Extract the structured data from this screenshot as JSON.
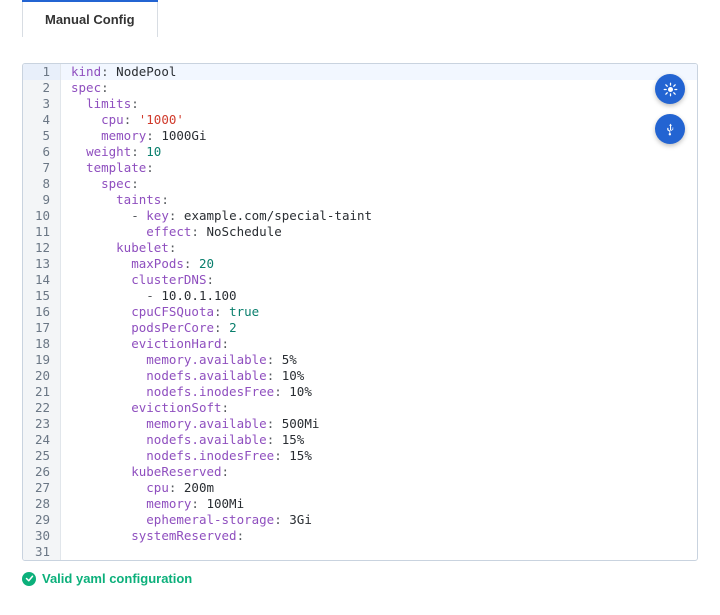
{
  "tabs": [
    {
      "label": "Manual Config",
      "selected": true
    }
  ],
  "actions": {
    "theme_label": "Toggle theme",
    "usb_label": "Connect device"
  },
  "status": {
    "text": "Valid yaml configuration"
  },
  "editor": {
    "highlight_line": 1,
    "lines": [
      {
        "tokens": [
          {
            "t": "k",
            "v": "kind"
          },
          {
            "t": "col",
            "v": ": "
          },
          {
            "t": "pln",
            "v": "NodePool"
          }
        ]
      },
      {
        "tokens": [
          {
            "t": "k",
            "v": "spec"
          },
          {
            "t": "col",
            "v": ":"
          }
        ]
      },
      {
        "tokens": [
          {
            "t": "sp",
            "v": "  "
          },
          {
            "t": "k",
            "v": "limits"
          },
          {
            "t": "col",
            "v": ":"
          }
        ]
      },
      {
        "tokens": [
          {
            "t": "sp",
            "v": "    "
          },
          {
            "t": "k",
            "v": "cpu"
          },
          {
            "t": "col",
            "v": ": "
          },
          {
            "t": "str",
            "v": "'1000'"
          }
        ]
      },
      {
        "tokens": [
          {
            "t": "sp",
            "v": "    "
          },
          {
            "t": "k",
            "v": "memory"
          },
          {
            "t": "col",
            "v": ": "
          },
          {
            "t": "pln",
            "v": "1000Gi"
          }
        ]
      },
      {
        "tokens": [
          {
            "t": "sp",
            "v": "  "
          },
          {
            "t": "k",
            "v": "weight"
          },
          {
            "t": "col",
            "v": ": "
          },
          {
            "t": "num",
            "v": "10"
          }
        ]
      },
      {
        "tokens": [
          {
            "t": "sp",
            "v": "  "
          },
          {
            "t": "k",
            "v": "template"
          },
          {
            "t": "col",
            "v": ":"
          }
        ]
      },
      {
        "tokens": [
          {
            "t": "sp",
            "v": "    "
          },
          {
            "t": "k",
            "v": "spec"
          },
          {
            "t": "col",
            "v": ":"
          }
        ]
      },
      {
        "tokens": [
          {
            "t": "sp",
            "v": "      "
          },
          {
            "t": "k",
            "v": "taints"
          },
          {
            "t": "col",
            "v": ":"
          }
        ]
      },
      {
        "tokens": [
          {
            "t": "sp",
            "v": "        "
          },
          {
            "t": "dsh",
            "v": "- "
          },
          {
            "t": "k",
            "v": "key"
          },
          {
            "t": "col",
            "v": ": "
          },
          {
            "t": "pln",
            "v": "example.com/special-taint"
          }
        ]
      },
      {
        "tokens": [
          {
            "t": "sp",
            "v": "          "
          },
          {
            "t": "k",
            "v": "effect"
          },
          {
            "t": "col",
            "v": ": "
          },
          {
            "t": "pln",
            "v": "NoSchedule"
          }
        ]
      },
      {
        "tokens": [
          {
            "t": "sp",
            "v": "      "
          },
          {
            "t": "k",
            "v": "kubelet"
          },
          {
            "t": "col",
            "v": ":"
          }
        ]
      },
      {
        "tokens": [
          {
            "t": "sp",
            "v": "        "
          },
          {
            "t": "k",
            "v": "maxPods"
          },
          {
            "t": "col",
            "v": ": "
          },
          {
            "t": "num",
            "v": "20"
          }
        ]
      },
      {
        "tokens": [
          {
            "t": "sp",
            "v": "        "
          },
          {
            "t": "k",
            "v": "clusterDNS"
          },
          {
            "t": "col",
            "v": ":"
          }
        ]
      },
      {
        "tokens": [
          {
            "t": "sp",
            "v": "          "
          },
          {
            "t": "dsh",
            "v": "- "
          },
          {
            "t": "pln",
            "v": "10.0.1.100"
          }
        ]
      },
      {
        "tokens": [
          {
            "t": "sp",
            "v": "        "
          },
          {
            "t": "k",
            "v": "cpuCFSQuota"
          },
          {
            "t": "col",
            "v": ": "
          },
          {
            "t": "lit",
            "v": "true"
          }
        ]
      },
      {
        "tokens": [
          {
            "t": "sp",
            "v": "        "
          },
          {
            "t": "k",
            "v": "podsPerCore"
          },
          {
            "t": "col",
            "v": ": "
          },
          {
            "t": "num",
            "v": "2"
          }
        ]
      },
      {
        "tokens": [
          {
            "t": "sp",
            "v": "        "
          },
          {
            "t": "k",
            "v": "evictionHard"
          },
          {
            "t": "col",
            "v": ":"
          }
        ]
      },
      {
        "tokens": [
          {
            "t": "sp",
            "v": "          "
          },
          {
            "t": "k",
            "v": "memory.available"
          },
          {
            "t": "col",
            "v": ": "
          },
          {
            "t": "pln",
            "v": "5%"
          }
        ]
      },
      {
        "tokens": [
          {
            "t": "sp",
            "v": "          "
          },
          {
            "t": "k",
            "v": "nodefs.available"
          },
          {
            "t": "col",
            "v": ": "
          },
          {
            "t": "pln",
            "v": "10%"
          }
        ]
      },
      {
        "tokens": [
          {
            "t": "sp",
            "v": "          "
          },
          {
            "t": "k",
            "v": "nodefs.inodesFree"
          },
          {
            "t": "col",
            "v": ": "
          },
          {
            "t": "pln",
            "v": "10%"
          }
        ]
      },
      {
        "tokens": [
          {
            "t": "sp",
            "v": "        "
          },
          {
            "t": "k",
            "v": "evictionSoft"
          },
          {
            "t": "col",
            "v": ":"
          }
        ]
      },
      {
        "tokens": [
          {
            "t": "sp",
            "v": "          "
          },
          {
            "t": "k",
            "v": "memory.available"
          },
          {
            "t": "col",
            "v": ": "
          },
          {
            "t": "pln",
            "v": "500Mi"
          }
        ]
      },
      {
        "tokens": [
          {
            "t": "sp",
            "v": "          "
          },
          {
            "t": "k",
            "v": "nodefs.available"
          },
          {
            "t": "col",
            "v": ": "
          },
          {
            "t": "pln",
            "v": "15%"
          }
        ]
      },
      {
        "tokens": [
          {
            "t": "sp",
            "v": "          "
          },
          {
            "t": "k",
            "v": "nodefs.inodesFree"
          },
          {
            "t": "col",
            "v": ": "
          },
          {
            "t": "pln",
            "v": "15%"
          }
        ]
      },
      {
        "tokens": [
          {
            "t": "sp",
            "v": "        "
          },
          {
            "t": "k",
            "v": "kubeReserved"
          },
          {
            "t": "col",
            "v": ":"
          }
        ]
      },
      {
        "tokens": [
          {
            "t": "sp",
            "v": "          "
          },
          {
            "t": "k",
            "v": "cpu"
          },
          {
            "t": "col",
            "v": ": "
          },
          {
            "t": "pln",
            "v": "200m"
          }
        ]
      },
      {
        "tokens": [
          {
            "t": "sp",
            "v": "          "
          },
          {
            "t": "k",
            "v": "memory"
          },
          {
            "t": "col",
            "v": ": "
          },
          {
            "t": "pln",
            "v": "100Mi"
          }
        ]
      },
      {
        "tokens": [
          {
            "t": "sp",
            "v": "          "
          },
          {
            "t": "k",
            "v": "ephemeral-storage"
          },
          {
            "t": "col",
            "v": ": "
          },
          {
            "t": "pln",
            "v": "3Gi"
          }
        ]
      },
      {
        "tokens": [
          {
            "t": "sp",
            "v": "        "
          },
          {
            "t": "k",
            "v": "systemReserved"
          },
          {
            "t": "col",
            "v": ":"
          }
        ]
      }
    ]
  }
}
